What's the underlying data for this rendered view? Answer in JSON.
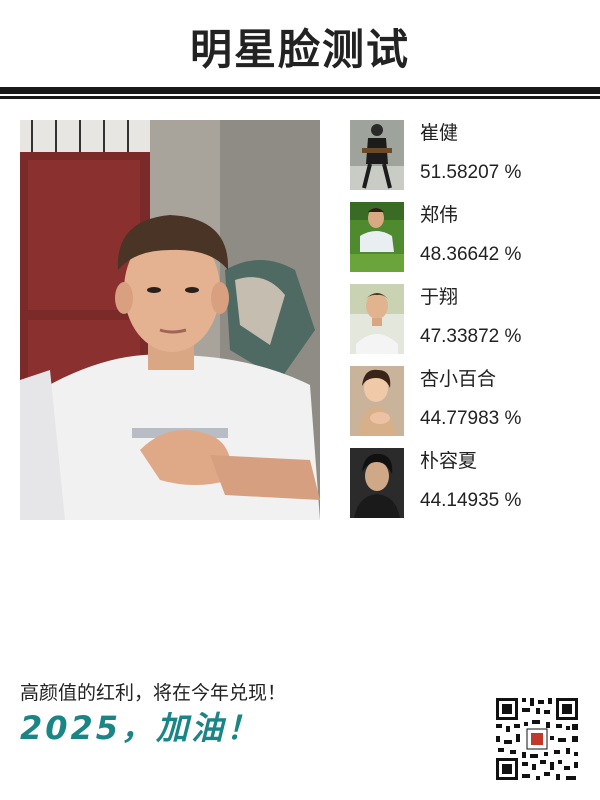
{
  "header": {
    "title": "明星脸测试"
  },
  "matches": [
    {
      "name": "崔健",
      "score": "51.58207 %"
    },
    {
      "name": "郑伟",
      "score": "48.36642 %"
    },
    {
      "name": "于翔",
      "score": "47.33872 %"
    },
    {
      "name": "杏小百合",
      "score": "44.77983 %"
    },
    {
      "name": "朴容夏",
      "score": "44.14935 %"
    }
  ],
  "footer": {
    "tagline": "高颜值的红利，将在今年兑现！",
    "cheer": "2025，加油！"
  },
  "colors": {
    "accent": "#1a8585",
    "rule": "#1a1a1a"
  },
  "icons": {
    "qr": "qr-code-icon"
  }
}
